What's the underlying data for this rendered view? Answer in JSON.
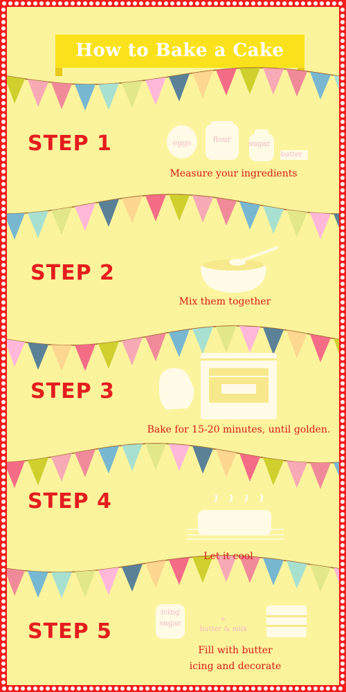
{
  "title": "How to Bake a Cake",
  "colors": {
    "border": "#f21c1c",
    "background": "#fbf49d",
    "banner": "#f9e21c",
    "text_red": "#e41d1d",
    "illustration": "#fffbe6",
    "pennant_palette": [
      "#cfd02e",
      "#f7a9b4",
      "#f08a99",
      "#77b7d0",
      "#a8e0d0",
      "#e2e78a",
      "#ffb8d8",
      "#5a8196",
      "#fdd68f",
      "#f46c86"
    ]
  },
  "steps": [
    {
      "label": "STEP 1",
      "caption": "Measure your ingredients",
      "ingredients": [
        "eggs",
        "flour",
        "sugar",
        "butter"
      ],
      "icon": "ingredient-jars-icon"
    },
    {
      "label": "STEP 2",
      "caption": "Mix them together",
      "icon": "mixing-bowl-icon"
    },
    {
      "label": "STEP 3",
      "caption": "Bake for 15-20 minutes, until golden.",
      "icon": "oven-icon"
    },
    {
      "label": "STEP 4",
      "caption": "Let it cool",
      "icon": "cooling-cake-icon"
    },
    {
      "label": "STEP 5",
      "caption_line1": "Fill with butter",
      "caption_line2": "icing and decorate",
      "jar_label_1": "icing",
      "jar_label_2": "sugar",
      "plus_label": "butter & milk",
      "icon": "layer-cake-icon"
    }
  ]
}
